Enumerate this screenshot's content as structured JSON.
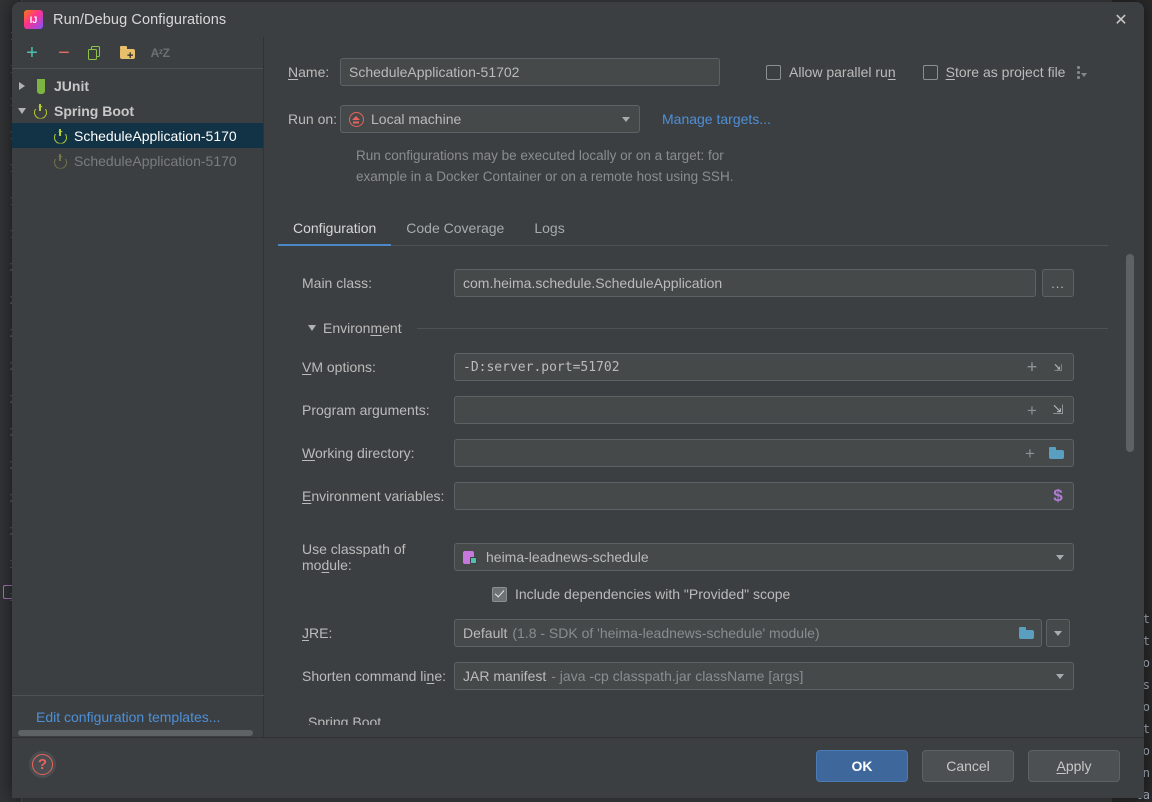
{
  "window": {
    "title": "Run/Debug Configurations",
    "app_icon": "intellij-idea-icon",
    "close_icon": "✕"
  },
  "background_ide": {
    "gutter_line_numbers": [
      "1",
      "1",
      "1",
      "1",
      "1",
      "1",
      "1",
      "2",
      "2",
      "2",
      "2",
      "2",
      "2",
      "2",
      "2",
      "2",
      "3",
      "3"
    ],
    "right_edge_fragments": [
      "St",
      "at",
      "lo",
      "s",
      "lo",
      "St",
      "lo",
      "n",
      "ta"
    ]
  },
  "tree_toolbar": {
    "add_label": "+",
    "remove_label": "−",
    "copy_label": "copy-configuration",
    "folder_label": "create-folder",
    "sort_label": "AᶻZ"
  },
  "tree": {
    "items": [
      {
        "label": "JUnit",
        "icon": "junit-icon",
        "twisty": "collapsed",
        "depth": 0,
        "state": "group"
      },
      {
        "label": "Spring Boot",
        "icon": "spring-boot-icon",
        "twisty": "expanded",
        "depth": 0,
        "state": "group"
      },
      {
        "label": "ScheduleApplication-5170",
        "icon": "spring-boot-icon",
        "twisty": "none",
        "depth": 1,
        "state": "selected"
      },
      {
        "label": "ScheduleApplication-5170",
        "icon": "spring-boot-icon",
        "twisty": "none",
        "depth": 1,
        "state": "temporary"
      }
    ],
    "edit_templates_link": "Edit configuration templates..."
  },
  "form": {
    "name_label": "Name:",
    "name_mnemonic": "N",
    "name_value": "ScheduleApplication-51702",
    "name_placeholder": "",
    "allow_parallel_run": {
      "label": "Allow parallel run",
      "mnemonic": "n",
      "checked": false
    },
    "store_as_project_file": {
      "label": "Store as project file",
      "mnemonic": "S",
      "checked": false
    },
    "run_on_label": "Run on:",
    "run_on_value": "Local machine",
    "run_on_icon": "home-icon",
    "manage_targets_link": "Manage targets...",
    "hint_line1": "Run configurations may be executed locally or on a target: for",
    "hint_line2": "example in a Docker Container or on a remote host using SSH."
  },
  "tabs": [
    {
      "label": "Configuration",
      "active": true
    },
    {
      "label": "Code Coverage",
      "active": false
    },
    {
      "label": "Logs",
      "active": false
    }
  ],
  "config": {
    "main_class_label": "Main class:",
    "main_class_value": "com.heima.schedule.ScheduleApplication",
    "main_class_browse": "...",
    "environment_section": "Environment",
    "environment_mnemonic": "m",
    "vm_options_label": "VM options:",
    "vm_options_mnemonic": "V",
    "vm_options_value": "-D:server.port=51702",
    "program_arguments_label": "Program arguments:",
    "program_arguments_value": "",
    "working_directory_label": "Working directory:",
    "working_directory_mnemonic": "W",
    "working_directory_value": "",
    "environment_variables_label": "Environment variables:",
    "environment_variables_mnemonic": "E",
    "environment_variables_value": "",
    "use_classpath_label": "Use classpath of module:",
    "use_classpath_mnemonic": "d",
    "use_classpath_value": "heima-leadnews-schedule",
    "use_classpath_icon": "module-icon",
    "include_dependencies": {
      "label": "Include dependencies with \"Provided\" scope",
      "checked": true
    },
    "jre_label": "JRE:",
    "jre_mnemonic": "J",
    "jre_value": "Default",
    "jre_value_detail": "(1.8 - SDK of 'heima-leadnews-schedule' module)",
    "shorten_cmd_label": "Shorten command line:",
    "shorten_cmd_mnemonic": "n",
    "shorten_cmd_value": "JAR manifest",
    "shorten_cmd_detail": "- java -cp classpath.jar className [args]",
    "clipped_section": "Spring Boot"
  },
  "footer": {
    "help_label": "?",
    "ok_label": "OK",
    "cancel_label": "Cancel",
    "apply_label": "Apply",
    "apply_mnemonic": "A"
  },
  "colors": {
    "accent_blue": "#4d90d8",
    "primary_button": "#3e679c",
    "tab_underline": "#4a88c7",
    "selection": "#123245",
    "panel_bg": "#3c3f41",
    "field_bg": "#45494a"
  }
}
